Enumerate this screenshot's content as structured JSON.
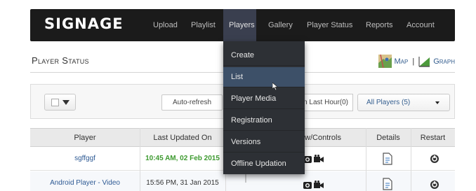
{
  "brand": "SIGNAGE",
  "nav": {
    "upload": "Upload",
    "playlist": "Playlist",
    "players": "Players",
    "gallery": "Gallery",
    "player_status": "Player Status",
    "reports": "Reports",
    "account": "Account"
  },
  "players_menu": {
    "items": [
      "Create",
      "List",
      "Player Media",
      "Registration",
      "Versions",
      "Offline Updation"
    ],
    "hovered": "List"
  },
  "page": {
    "title": "Player Status",
    "map_link": "Map",
    "graph_link": "Graph",
    "separator": "|"
  },
  "toolbar": {
    "auto_refresh": "Auto-refresh",
    "range": "n Last Hour(0)",
    "players_filter": "All Players (5)"
  },
  "table": {
    "headers": {
      "player": "Player",
      "last_updated": "Last Updated On",
      "controls": "w/Controls",
      "details": "Details",
      "restart": "Restart"
    },
    "rows": [
      {
        "player": "sgffggf",
        "last_updated": "10:45 AM, 02 Feb 2015"
      },
      {
        "player": "Android Player - Video",
        "last_updated": "15:56 PM, 31 Jan 2015"
      }
    ]
  },
  "colors": {
    "navbar": "#1b1b1b",
    "dropdown": "#2d3035",
    "dropdown_hover": "#3d5068",
    "link": "#2e5a94",
    "recent_time": "#3d9a2f"
  }
}
